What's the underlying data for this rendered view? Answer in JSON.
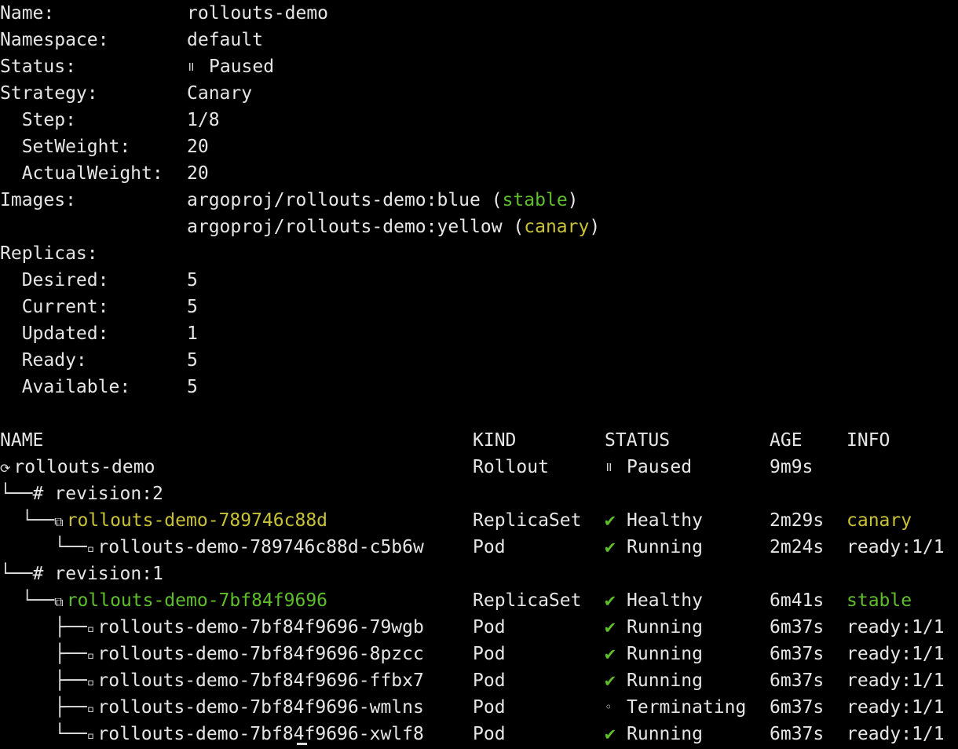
{
  "summary": {
    "name_label": "Name:",
    "name_value": "rollouts-demo",
    "namespace_label": "Namespace:",
    "namespace_value": "default",
    "status_label": "Status:",
    "status_icon": "॥",
    "status_value": "Paused",
    "strategy_label": "Strategy:",
    "strategy_value": "Canary",
    "step_label": "  Step:",
    "step_value": "1/8",
    "setweight_label": "  SetWeight:",
    "setweight_value": "20",
    "actualweight_label": "  ActualWeight:",
    "actualweight_value": "20",
    "images_label": "Images:",
    "image1_name": "argoproj/rollouts-demo:blue (",
    "image1_tag": "stable",
    "image1_close": ")",
    "image2_name": "argoproj/rollouts-demo:yellow (",
    "image2_tag": "canary",
    "image2_close": ")",
    "replicas_label": "Replicas:",
    "desired_label": "  Desired:",
    "desired_value": "5",
    "current_label": "  Current:",
    "current_value": "5",
    "updated_label": "  Updated:",
    "updated_value": "1",
    "ready_label": "  Ready:",
    "ready_value": "5",
    "available_label": "  Available:",
    "available_value": "5"
  },
  "table": {
    "headers": {
      "name": "NAME",
      "kind": "KIND",
      "status": "STATUS",
      "age": "AGE",
      "info": "INFO"
    },
    "rows": [
      {
        "prefix": "",
        "icon": "⟳",
        "name": "rollouts-demo",
        "kind": "Rollout",
        "status_icon": "॥",
        "status": "Paused",
        "age": "9m9s",
        "info": ""
      },
      {
        "prefix": "└──",
        "icon": "#",
        "name": "revision:2",
        "kind": "",
        "status_icon": "",
        "status": "",
        "age": "",
        "info": ""
      },
      {
        "prefix": "  └──",
        "icon": "⧉",
        "name": "rollouts-demo-789746c88d",
        "kind": "ReplicaSet",
        "status_icon": "✔",
        "status": "Healthy",
        "age": "2m29s",
        "info": "canary"
      },
      {
        "prefix": "     └──",
        "icon": "▫",
        "name": "rollouts-demo-789746c88d-c5b6w",
        "kind": "Pod",
        "status_icon": "✔",
        "status": "Running",
        "age": "2m24s",
        "info": "ready:1/1"
      },
      {
        "prefix": "└──",
        "icon": "#",
        "name": "revision:1",
        "kind": "",
        "status_icon": "",
        "status": "",
        "age": "",
        "info": ""
      },
      {
        "prefix": "  └──",
        "icon": "⧉",
        "name": "rollouts-demo-7bf84f9696",
        "kind": "ReplicaSet",
        "status_icon": "✔",
        "status": "Healthy",
        "age": "6m41s",
        "info": "stable"
      },
      {
        "prefix": "     ├──",
        "icon": "▫",
        "name": "rollouts-demo-7bf84f9696-79wgb",
        "kind": "Pod",
        "status_icon": "✔",
        "status": "Running",
        "age": "6m37s",
        "info": "ready:1/1"
      },
      {
        "prefix": "     ├──",
        "icon": "▫",
        "name": "rollouts-demo-7bf84f9696-8pzcc",
        "kind": "Pod",
        "status_icon": "✔",
        "status": "Running",
        "age": "6m37s",
        "info": "ready:1/1"
      },
      {
        "prefix": "     ├──",
        "icon": "▫",
        "name": "rollouts-demo-7bf84f9696-ffbx7",
        "kind": "Pod",
        "status_icon": "✔",
        "status": "Running",
        "age": "6m37s",
        "info": "ready:1/1"
      },
      {
        "prefix": "     ├──",
        "icon": "▫",
        "name": "rollouts-demo-7bf84f9696-wmlns",
        "kind": "Pod",
        "status_icon": "◦",
        "status": "Terminating",
        "age": "6m37s",
        "info": "ready:1/1"
      },
      {
        "prefix": "     └──",
        "icon": "▫",
        "name": "rollouts-demo-7bf84f9696-xwlf8",
        "kind": "Pod",
        "status_icon": "✔",
        "status": "Running",
        "age": "6m37s",
        "info": "ready:1/1"
      }
    ]
  },
  "colors": {
    "background": "#000000",
    "text": "#e6e6e6",
    "green": "#5fbf2a",
    "yellow": "#c9c236"
  }
}
